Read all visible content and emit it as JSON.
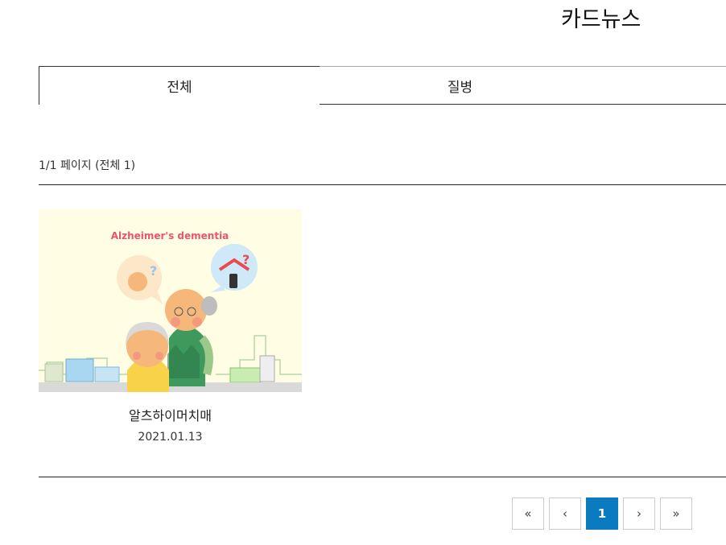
{
  "page": {
    "title": "카드뉴스"
  },
  "tabs": [
    {
      "label": "전체",
      "active": true
    },
    {
      "label": "질병",
      "active": false
    },
    {
      "label": "",
      "active": false
    }
  ],
  "list": {
    "page_info": "1/1 페이지 (전체 1)"
  },
  "cards": [
    {
      "title": "알츠하이머치매",
      "date": "2021.01.13",
      "image_caption": "Alzheimer's dementia"
    }
  ],
  "pagination": {
    "first_icon": "double-chevron-left-icon",
    "prev_icon": "chevron-left-icon",
    "current": "1",
    "next_icon": "chevron-right-icon",
    "last_icon": "double-chevron-right-icon",
    "first_glyph": "«",
    "prev_glyph": "‹",
    "next_glyph": "›",
    "last_glyph": "»"
  },
  "colors": {
    "accent": "#0b7bc1",
    "thumb_bg": "#fffde3",
    "caption": "#e8566b"
  }
}
